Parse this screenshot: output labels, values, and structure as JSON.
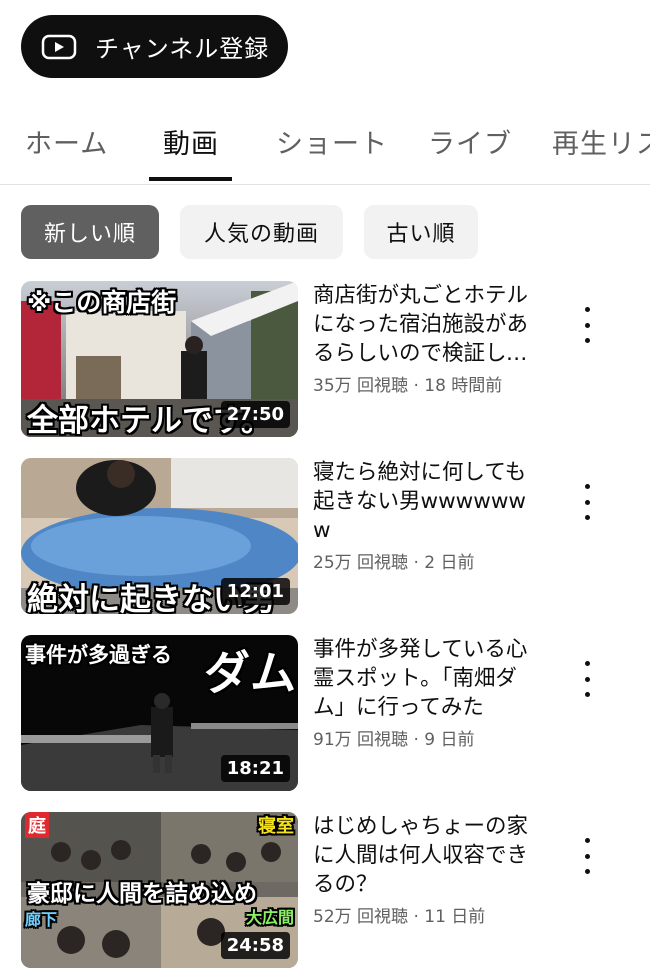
{
  "subscribe": {
    "label": "チャンネル登録",
    "icon": "youtube-play-icon"
  },
  "tabs": [
    {
      "label": "ホーム",
      "active": false
    },
    {
      "label": "動画",
      "active": true
    },
    {
      "label": "ショート",
      "active": false
    },
    {
      "label": "ライブ",
      "active": false
    },
    {
      "label": "再生リスト",
      "active": false
    }
  ],
  "filters": [
    {
      "label": "新しい順",
      "active": true
    },
    {
      "label": "人気の動画",
      "active": false
    },
    {
      "label": "古い順",
      "active": false
    }
  ],
  "videos": [
    {
      "title": "商店街が丸ごとホテルになった宿泊施設があるらしいので検証してみた",
      "views": "35万 回視聴",
      "age": "18 時間前",
      "duration": "27:50",
      "thumb_text_top": "※この商店街",
      "thumb_text_bottom": "全部ホテルです。"
    },
    {
      "title": "寝たら絶対に何しても起きない男wwwwwww",
      "views": "25万 回視聴",
      "age": "2 日前",
      "duration": "12:01",
      "thumb_text_bottom": "絶対に起きない男"
    },
    {
      "title": "事件が多発している心霊スポット。「南畑ダム」に行ってみた",
      "views": "91万 回視聴",
      "age": "9 日前",
      "duration": "18:21",
      "thumb_text_top": "事件が多過ぎる",
      "thumb_text_big": "ダム"
    },
    {
      "title": "はじめしゃちょーの家に人間は何人収容できるの？",
      "views": "52万 回視聴",
      "age": "11 日前",
      "duration": "24:58",
      "thumb_text_main": "豪邸に人間を詰め込め",
      "thumb_tag_left_top": "庭",
      "thumb_tag_right_top": "寝室",
      "thumb_tag_left_bottom": "廊下",
      "thumb_tag_right_bottom": "大広間"
    }
  ]
}
